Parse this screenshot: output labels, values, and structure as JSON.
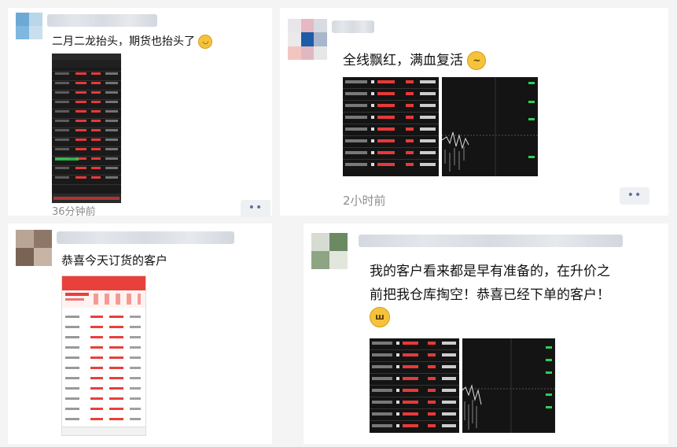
{
  "posts": [
    {
      "text": "二月二龙抬头，期货也抬头了",
      "emoji": "smile-emoji",
      "time": "36分钟前",
      "more": "••"
    },
    {
      "text": "全线飘红，满血复活",
      "emoji": "thinking-emoji",
      "time": "2小时前",
      "more": "••"
    },
    {
      "text": "恭喜今天订货的客户"
    },
    {
      "text_line1": "我的客户看来都是早有准备的，在升价之",
      "text_line2": "前把我仓库掏空！恭喜已经下单的客户！",
      "emoji": "grin-emoji"
    }
  ],
  "colors": {
    "red": "#e53a3a",
    "green": "#2fcf52",
    "bg": "#141414"
  }
}
